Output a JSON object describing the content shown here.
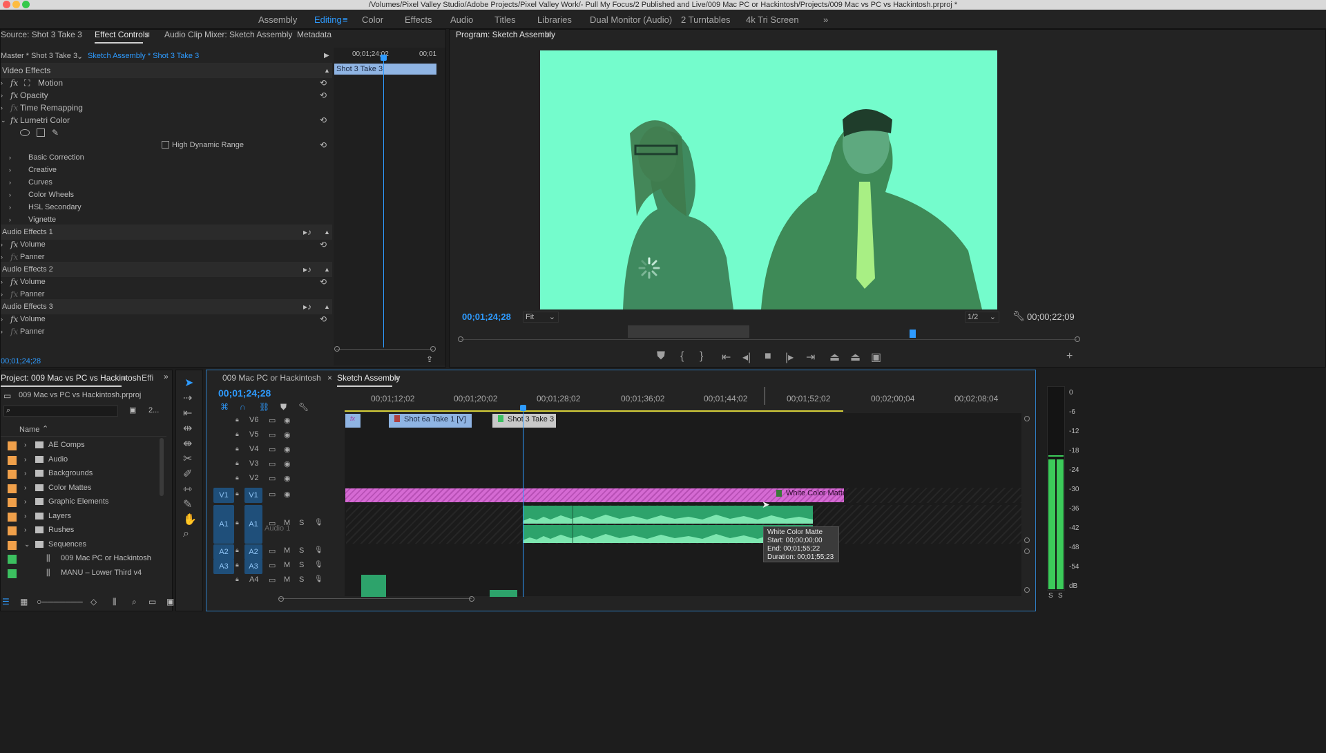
{
  "titlebar": {
    "path": "/Volumes/Pixel Valley Studio/Adobe Projects/Pixel Valley Work/- Pull My Focus/2 Published and Live/009 Mac PC or Hackintosh/Projects/009 Mac vs PC vs Hackintosh.prproj *"
  },
  "workspaces": [
    "Assembly",
    "Editing",
    "Color",
    "Effects",
    "Audio",
    "Titles",
    "Libraries",
    "Dual Monitor (Audio)",
    "2 Turntables",
    "4k Tri Screen"
  ],
  "workspace_more": "»",
  "source_panel": {
    "tabs": [
      "Source: Shot 3 Take 3",
      "Effect Controls",
      "Audio Clip Mixer: Sketch Assembly",
      "Metadata"
    ],
    "master_label": "Master * Shot 3 Take 3",
    "sequence_label": "Sketch Assembly * Shot 3 Take 3",
    "mini_time_start": "00;01;24;02",
    "mini_time_end": "00;01",
    "mini_clip": "Shot 3 Take 3",
    "rows": {
      "video_effects": "Video Effects",
      "motion": "Motion",
      "opacity": "Opacity",
      "time_remapping": "Time Remapping",
      "lumetri": "Lumetri Color",
      "hdr": "High Dynamic Range",
      "basic_correction": "Basic Correction",
      "creative": "Creative",
      "curves": "Curves",
      "color_wheels": "Color Wheels",
      "hsl_secondary": "HSL Secondary",
      "vignette": "Vignette",
      "audio_effects_1": "Audio Effects 1",
      "audio_effects_2": "Audio Effects 2",
      "audio_effects_3": "Audio Effects 3",
      "volume": "Volume",
      "panner": "Panner",
      "fx": "fx"
    },
    "timecode": "00;01;24;28"
  },
  "program_panel": {
    "title": "Program: Sketch Assembly",
    "timecode": "00;01;24;28",
    "fit": "Fit",
    "resolution": "1/2",
    "duration": "00;00;22;09"
  },
  "project_panel": {
    "tab": "Project: 009 Mac vs PC vs Hackintosh",
    "tab2": "Effi",
    "filename": "009 Mac vs PC vs Hackintosh.prproj",
    "count": "2...",
    "column": "Name",
    "items": [
      {
        "name": "AE Comps",
        "kind": "folder",
        "color": "#f0a04a"
      },
      {
        "name": "Audio",
        "kind": "folder",
        "color": "#f0a04a"
      },
      {
        "name": "Backgrounds",
        "kind": "folder",
        "color": "#f0a04a"
      },
      {
        "name": "Color Mattes",
        "kind": "folder",
        "color": "#f0a04a"
      },
      {
        "name": "Graphic Elements",
        "kind": "folder",
        "color": "#f0a04a"
      },
      {
        "name": "Layers",
        "kind": "folder",
        "color": "#f0a04a"
      },
      {
        "name": "Rushes",
        "kind": "folder",
        "color": "#f0a04a"
      },
      {
        "name": "Sequences",
        "kind": "folder-open",
        "color": "#f0a04a"
      },
      {
        "name": "009 Mac PC or Hackintosh",
        "kind": "sequence",
        "color": "#3cc060"
      },
      {
        "name": "MANU – Lower Third v4",
        "kind": "sequence",
        "color": "#3cc060"
      }
    ]
  },
  "timeline": {
    "tabs": [
      "009 Mac PC or Hackintosh",
      "Sketch Assembly"
    ],
    "close": "×",
    "timecode": "00;01;24;28",
    "ruler": [
      "00;01;12;02",
      "00;01;20;02",
      "00;01;28;02",
      "00;01;36;02",
      "00;01;44;02",
      "00;01;52;02",
      "00;02;00;04",
      "00;02;08;04"
    ],
    "tracks": [
      "V6",
      "V5",
      "V4",
      "V3",
      "V2",
      "V1",
      "A1",
      "A2",
      "A3",
      "A4"
    ],
    "clips": {
      "shot6a": "Shot 6a Take 1 [V]",
      "shot3": "Shot 3 Take 3 [",
      "white_matte": "White Color Matte",
      "audio1": "Audio 1"
    },
    "tooltip": {
      "title": "White Color Matte",
      "start": "Start: 00;00;00;00",
      "end": "End: 00;01;55;22",
      "duration": "Duration: 00;01;55;23"
    },
    "colors": {
      "video_clip": "#8fb4e3",
      "matte": "#d56ad3",
      "audio": "#2da36b",
      "target": "#1f4f7a"
    }
  },
  "meter": {
    "scale": [
      "0",
      "-6",
      "-12",
      "-18",
      "-24",
      "-30",
      "-36",
      "-42",
      "-48",
      "-54",
      "dB"
    ],
    "solo": [
      "S",
      "S"
    ]
  }
}
